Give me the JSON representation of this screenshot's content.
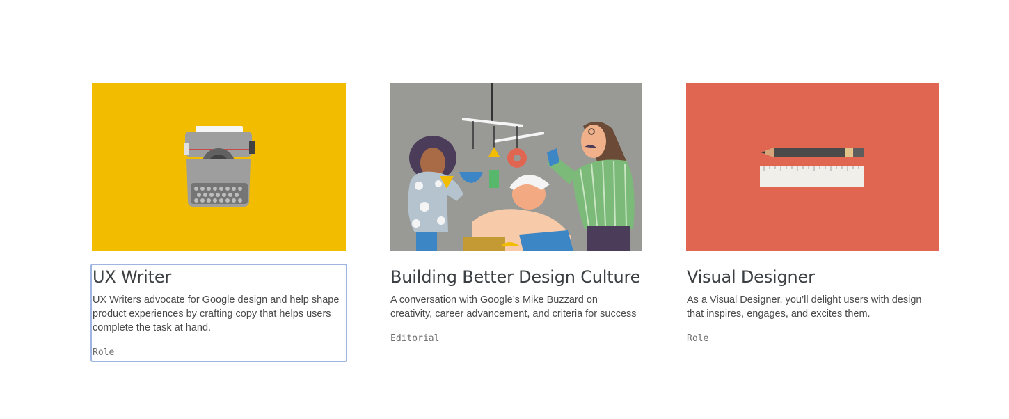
{
  "cards": [
    {
      "title": "UX Writer",
      "description": "UX Writers advocate for Google design and help shape product experiences by crafting copy that helps users complete the task at hand.",
      "tag": "Role",
      "image_bg": "#f2bd00",
      "focused": true
    },
    {
      "title": "Building Better Design Culture",
      "description": "A conversation with Google’s Mike Buzzard on creativity, career advancement, and criteria for success",
      "tag": "Editorial",
      "image_bg": "#999a96",
      "focused": false
    },
    {
      "title": "Visual Designer",
      "description": "As a Visual Designer, you’ll delight users with design that inspires, engages, and excites them.",
      "tag": "Role",
      "image_bg": "#e06652",
      "focused": false
    }
  ]
}
